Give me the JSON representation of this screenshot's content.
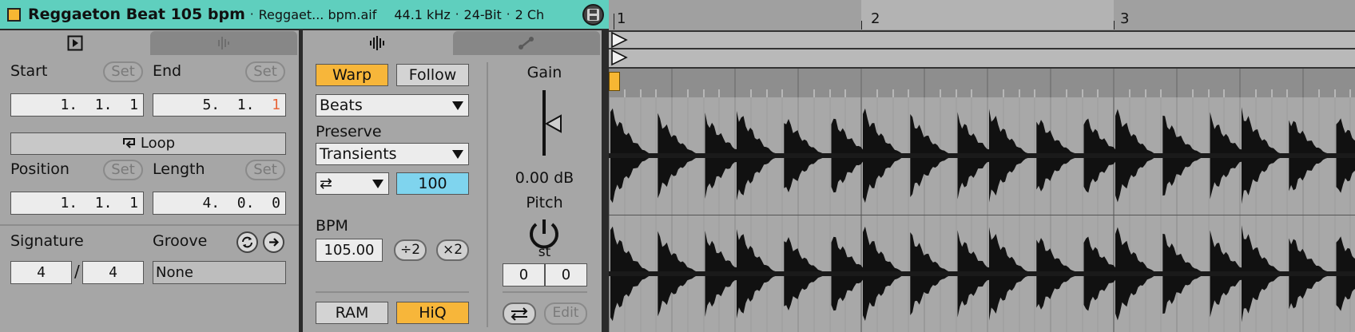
{
  "header": {
    "clip_name": "Reggaeton Beat 105 bpm",
    "file_name": "Reggaet... bpm.aif",
    "sample_rate": "44.1 kHz",
    "bit_depth": "24-Bit",
    "channels": "2 Ch",
    "separator": "·",
    "clip_color": "#f7b733"
  },
  "clip_panel": {
    "tabs": [
      "clip-tab",
      "sample-tab"
    ],
    "start_label": "Start",
    "end_label": "End",
    "set_label": "Set",
    "start_value": "1.  1.  1",
    "end_value_main": "5.  1.  ",
    "end_value_last": "1",
    "loop_label": "Loop",
    "position_label": "Position",
    "length_label": "Length",
    "position_value": "1.  1.  1",
    "length_value": "4.  0.  0",
    "signature_label": "Signature",
    "groove_label": "Groove",
    "sig_numerator": "4",
    "sig_slash": "/",
    "sig_denominator": "4",
    "groove_value": "None"
  },
  "sample_panel": {
    "warp_label": "Warp",
    "follow_label": "Follow",
    "warp_mode": "Beats",
    "preserve_label": "Preserve",
    "preserve_value": "Transients",
    "loop_mode_value": "⇄",
    "envelope_value": "100",
    "bpm_label": "BPM",
    "bpm_value": "105.00",
    "half_label": "÷2",
    "double_label": "×2",
    "ram_label": "RAM",
    "hiq_label": "HiQ",
    "gain_label": "Gain",
    "gain_value": "0.00 dB",
    "pitch_label": "Pitch",
    "pitch_unit": "st",
    "transpose_value": "0",
    "detune_value": "0",
    "edit_label": "Edit",
    "accent_orange": "#f7b63a",
    "accent_blue": "#7fd4ee"
  },
  "arrangement": {
    "bar_labels": [
      "1",
      "2",
      "3"
    ]
  }
}
